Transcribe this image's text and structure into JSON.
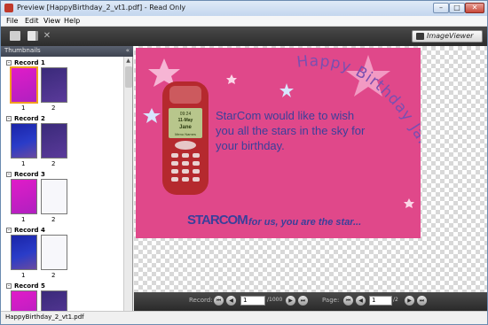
{
  "window": {
    "title": "Preview [HappyBirthday_2_vt1.pdf] - Read Only",
    "app_icon": "pdf-app-icon",
    "controls": [
      "minimize",
      "maximize",
      "close"
    ]
  },
  "menu": [
    "File",
    "Edit",
    "View",
    "Help"
  ],
  "toolbar": {
    "icons": [
      "save-icon",
      "document-icon",
      "close-icon"
    ],
    "image_viewer_label": "ImageViewer"
  },
  "sidebar": {
    "title": "Thumbnails",
    "records": [
      {
        "label": "Record 1",
        "pages": [
          "1",
          "2"
        ]
      },
      {
        "label": "Record 2",
        "pages": [
          "1",
          "2"
        ]
      },
      {
        "label": "Record 3",
        "pages": [
          "1",
          "2"
        ]
      },
      {
        "label": "Record 4",
        "pages": [
          "1",
          "2"
        ]
      },
      {
        "label": "Record 5",
        "pages": []
      }
    ]
  },
  "card": {
    "heading": "Happy Birthday Jane!",
    "message": "StarCom would like to wish you all the stars in the sky for your birthday.",
    "brand": "STARCOM",
    "tagline": "for us, you are the star...",
    "phone_screen": [
      "09:24",
      "11-May",
      "Jane",
      "Menu Names"
    ],
    "colors": {
      "background": "#e0488a",
      "text": "#3a3f9a",
      "heading": "#7a4fb0"
    }
  },
  "navigation": {
    "record_label": "Record:",
    "record_value": "1",
    "record_total": "/1000",
    "page_label": "Page:",
    "page_value": "1",
    "page_total": "/2"
  },
  "status": {
    "filename": "HappyBirthday_2_vt1.pdf"
  }
}
